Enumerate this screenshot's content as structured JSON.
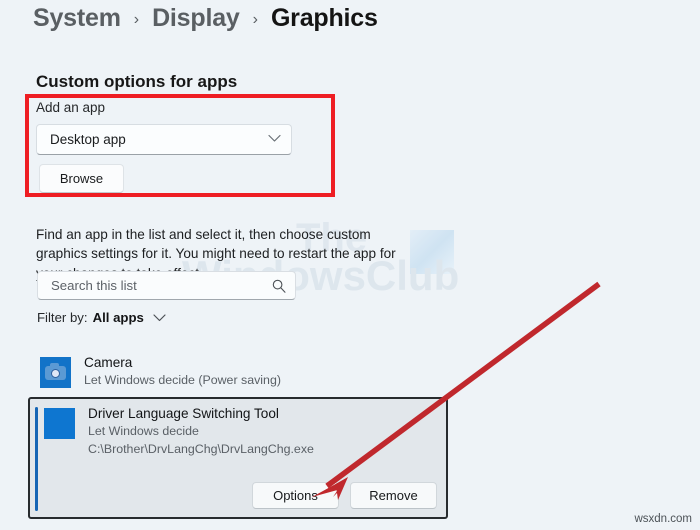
{
  "breadcrumb": {
    "items": [
      {
        "label": "System",
        "current": false
      },
      {
        "label": "Display",
        "current": false
      },
      {
        "label": "Graphics",
        "current": true
      }
    ],
    "separator": "›"
  },
  "section": {
    "heading": "Custom options for apps"
  },
  "add_app": {
    "label": "Add an app",
    "select_value": "Desktop app",
    "select_chevron": "chevron-down",
    "browse_label": "Browse",
    "highlight_color": "#ee1d23"
  },
  "description": {
    "text": "Find an app in the list and select it, then choose custom graphics settings for it. You might need to restart the app for your changes to take effect."
  },
  "search": {
    "placeholder": "Search this list",
    "value": "",
    "icon": "search-icon"
  },
  "filter": {
    "label": "Filter by:",
    "value": "All apps",
    "chevron": "chevron-down"
  },
  "app_list": [
    {
      "name": "Camera",
      "status": "Let Windows decide (Power saving)",
      "path": "",
      "icon": "camera-icon",
      "selected": false
    }
  ],
  "selected_app": {
    "name": "Driver Language Switching Tool",
    "status": "Let Windows decide",
    "path": "C:\\Brother\\DrvLangChg\\DrvLangChg.exe",
    "icon": "app-tile-icon",
    "accent_color": "#1565b5",
    "actions": [
      {
        "label": "Options"
      },
      {
        "label": "Remove"
      }
    ]
  },
  "annotation": {
    "arrow_color": "#c0282d",
    "points_to": "Options"
  },
  "watermark": {
    "line1": "The",
    "line2": "WindowsClub"
  },
  "credit": {
    "text": "wsxdn.com"
  }
}
